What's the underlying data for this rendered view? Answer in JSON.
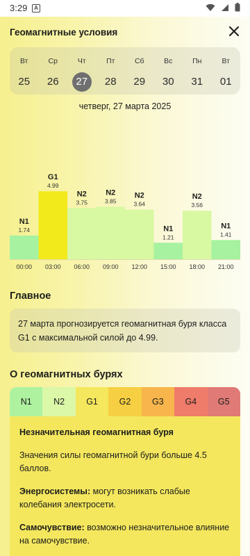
{
  "status": {
    "time": "3:29",
    "a_badge": "A"
  },
  "header": {
    "title": "Геомагнитные условия"
  },
  "days": [
    {
      "dow": "Вт",
      "num": "25"
    },
    {
      "dow": "Ср",
      "num": "26"
    },
    {
      "dow": "Чт",
      "num": "27",
      "selected": true
    },
    {
      "dow": "Пт",
      "num": "28"
    },
    {
      "dow": "Сб",
      "num": "29"
    },
    {
      "dow": "Вс",
      "num": "30"
    },
    {
      "dow": "Пн",
      "num": "31"
    },
    {
      "dow": "Вт",
      "num": "01"
    }
  ],
  "date_label": "четверг, 27 марта 2025",
  "chart_data": {
    "type": "bar",
    "categories": [
      "00:00",
      "03:00",
      "06:00",
      "09:00",
      "12:00",
      "15:00",
      "18:00",
      "21:00"
    ],
    "values": [
      1.74,
      4.99,
      3.75,
      3.85,
      3.64,
      1.21,
      3.56,
      1.41
    ],
    "levels": [
      "N1",
      "G1",
      "N2",
      "N2",
      "N2",
      "N1",
      "N2",
      "N1"
    ],
    "value_labels": [
      "1.74",
      "4.99",
      "3.75",
      "3.85",
      "3.64",
      "1.21",
      "3.56",
      "1.41"
    ],
    "ylim": [
      0,
      5
    ],
    "level_colors": {
      "N1": "#a6f2a0",
      "N2": "#d8f8a2",
      "G1": "#f3ea1c"
    }
  },
  "main": {
    "title": "Главное",
    "summary": "27 марта прогнозируется геомагнитная буря класса G1 с максимальной силой до 4.99."
  },
  "about": {
    "title": "О геомагнитных бурях",
    "tabs": [
      {
        "label": "N1",
        "color": "#aef2a0"
      },
      {
        "label": "N2",
        "color": "#dbf8a8"
      },
      {
        "label": "G1",
        "color": "#f4e75e",
        "active": true
      },
      {
        "label": "G2",
        "color": "#f7cf42"
      },
      {
        "label": "G3",
        "color": "#f7b54c"
      },
      {
        "label": "G4",
        "color": "#ef7b6a"
      },
      {
        "label": "G5",
        "color": "#e07a76"
      }
    ],
    "card": {
      "heading": "Незначительная геомагнитная буря",
      "text1": "Значения силы геомагнитной бури больше 4.5 баллов.",
      "energy_label": "Энергосистемы:",
      "energy_text": " могут возникать слабые колебания электросети.",
      "health_label": "Самочувствие:",
      "health_text": " возможно незначительное влияние на самочувствие."
    }
  }
}
